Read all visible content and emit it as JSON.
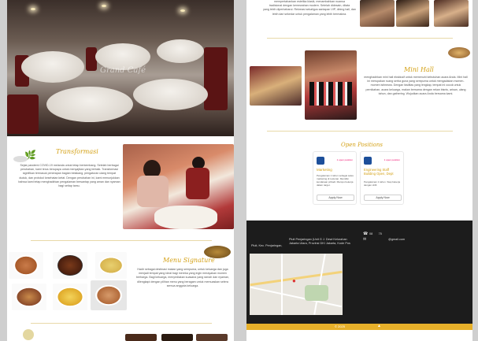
{
  "hero": {
    "title": "Grand Café"
  },
  "transformasi": {
    "title": "Transformasi",
    "body": "Sejak pandemi COVID-19 melanda untuk tetap berkembang. Setelah berbagai perubahan, kami terus berupaya untuk menyajikan yang terbaik. Transformasi signifikan termasuk penerapan bagian belakang, pengaturan ulang tempat duduk, dan protokol kesehatan ketat. Dengan perubahan ini, kami menunjukkan bahwa kami tetap menghadirkan pengalaman bersantap yang aman dan nyaman bagi setiap tamu."
  },
  "menu_signature": {
    "title": "Menu Signature",
    "body": "Hadir sebagai destinasi makan yang sempurna, untuk keluarga dan juga menjadi tempat yang ideal bagi mereka yang ingin merayakan momen berharga. Bagi keluarga, menyediakan suasana yang ramah dan nyaman, dilengkapi dengan pilihan menu yang beragam untuk memuaskan selera semua anggota keluarga."
  },
  "top_text": {
    "line1": "mempertahankan estetika klasik, menambahkan nuansa",
    "line2": "tradisional dengan kemewahan modern. Setelah didesain, ditata",
    "line3": "yang lebih diperbaharui. Rekreasi sekaligus santapan VIP, dining hall, dan",
    "line4": "lebih dari sekedar untuk pengalaman yang lebih bermakna."
  },
  "mini_hall": {
    "title": "Mini Hall",
    "body": "menghadirkan mini hall eksklusif untuk memenuhi kebutuhan acara Anda. Mini hall ini merupakan ruang serba guna yang sempurna untuk mengadakan momen-momen istimewa. Dengan fasilitas yang lengkap, tempat ini cocok untuk pernikahan, acara keluarga, makan bersama dengan rekan bisnis, arisan, ulang tahun, dan gathering. Wujudkan acara Anda bersama kami."
  },
  "open_positions": {
    "title": "Open Positions",
    "jobs": [
      {
        "badge": "1 open position",
        "title": "Marketing",
        "desc": "Pengalaman 1 tahun sebagai sales marketing di restoran. Memiliki kendaraan pribadi. Mampu bekerja dalam target.",
        "apply": "Apply Now"
      },
      {
        "badge": "1 open position",
        "title": "Engineering Staff Building",
        "subtitle": "Open, Dept",
        "desc": "Pengalaman 1 tahun. Siap bekerja dengan shift.",
        "apply": "Apply Now"
      }
    ]
  },
  "footer": {
    "phone_prefix": "08",
    "phone_suffix": "75",
    "email": "@gmail.com",
    "address_a": "Pluit, Kec. Penjaringan,",
    "address_b": "Pluit Penjaringan (Unit G",
    "address_c": "Jakarta Utara, Provinsi DKI Jakarta, Kode Pos",
    "address_d": "J. Dewi Kelurahan",
    "copyright": "© 2025"
  },
  "colors": {
    "accent": "#d4a116",
    "footer_bg": "#1c1c1c",
    "bar": "#e7b02a"
  },
  "icons": [
    "basil-leaf-icon",
    "phone-icon",
    "mail-icon",
    "location-pin-icon"
  ]
}
